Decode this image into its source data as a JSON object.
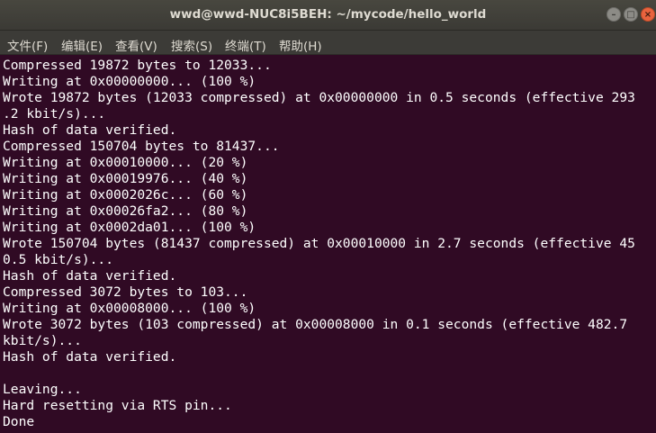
{
  "window": {
    "title": "wwd@wwd-NUC8i5BEH: ~/mycode/hello_world",
    "controls": {
      "minimize_icon": "minimize-icon",
      "maximize_icon": "maximize-icon",
      "close_icon": "close-icon"
    }
  },
  "menu": {
    "items": [
      {
        "label": "文件(F)"
      },
      {
        "label": "编辑(E)"
      },
      {
        "label": "查看(V)"
      },
      {
        "label": "搜索(S)"
      },
      {
        "label": "终端(T)"
      },
      {
        "label": "帮助(H)"
      }
    ]
  },
  "terminal": {
    "lines": [
      "Compressed 19872 bytes to 12033...",
      "Writing at 0x00000000... (100 %)",
      "Wrote 19872 bytes (12033 compressed) at 0x00000000 in 0.5 seconds (effective 293",
      ".2 kbit/s)...",
      "Hash of data verified.",
      "Compressed 150704 bytes to 81437...",
      "Writing at 0x00010000... (20 %)",
      "Writing at 0x00019976... (40 %)",
      "Writing at 0x0002026c... (60 %)",
      "Writing at 0x00026fa2... (80 %)",
      "Writing at 0x0002da01... (100 %)",
      "Wrote 150704 bytes (81437 compressed) at 0x00010000 in 2.7 seconds (effective 45",
      "0.5 kbit/s)...",
      "Hash of data verified.",
      "Compressed 3072 bytes to 103...",
      "Writing at 0x00008000... (100 %)",
      "Wrote 3072 bytes (103 compressed) at 0x00008000 in 0.1 seconds (effective 482.7",
      "kbit/s)...",
      "Hash of data verified.",
      "",
      "Leaving...",
      "Hard resetting via RTS pin...",
      "Done"
    ]
  },
  "colors": {
    "background": "#300a24",
    "foreground": "#ffffff",
    "titlebar": "#3c3b37",
    "close_button": "#e9633e"
  }
}
